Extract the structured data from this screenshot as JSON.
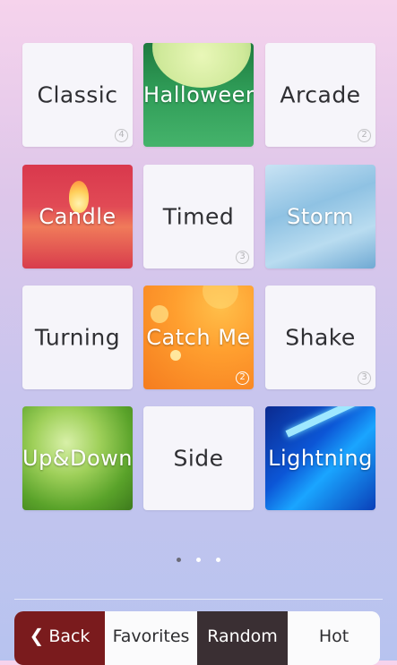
{
  "tiles": [
    {
      "label": "Classic",
      "badge": "4"
    },
    {
      "label": "Halloween",
      "badge": ""
    },
    {
      "label": "Arcade",
      "badge": "2"
    },
    {
      "label": "Candle",
      "badge": ""
    },
    {
      "label": "Timed",
      "badge": "3"
    },
    {
      "label": "Storm",
      "badge": ""
    },
    {
      "label": "Turning",
      "badge": ""
    },
    {
      "label": "Catch Me",
      "badge": "2"
    },
    {
      "label": "Shake",
      "badge": "3"
    },
    {
      "label": "Up&Down",
      "badge": ""
    },
    {
      "label": "Side",
      "badge": ""
    },
    {
      "label": "Lightning",
      "badge": ""
    }
  ],
  "pager": {
    "pages": 3,
    "active": 1
  },
  "bottom_nav": {
    "back": "Back",
    "favorites": "Favorites",
    "random": "Random",
    "hot": "Hot"
  },
  "icons": {
    "back": "chevron-left-icon"
  },
  "colors": {
    "back_bg": "#7a1b1d",
    "random_bg": "#3a2f33"
  }
}
